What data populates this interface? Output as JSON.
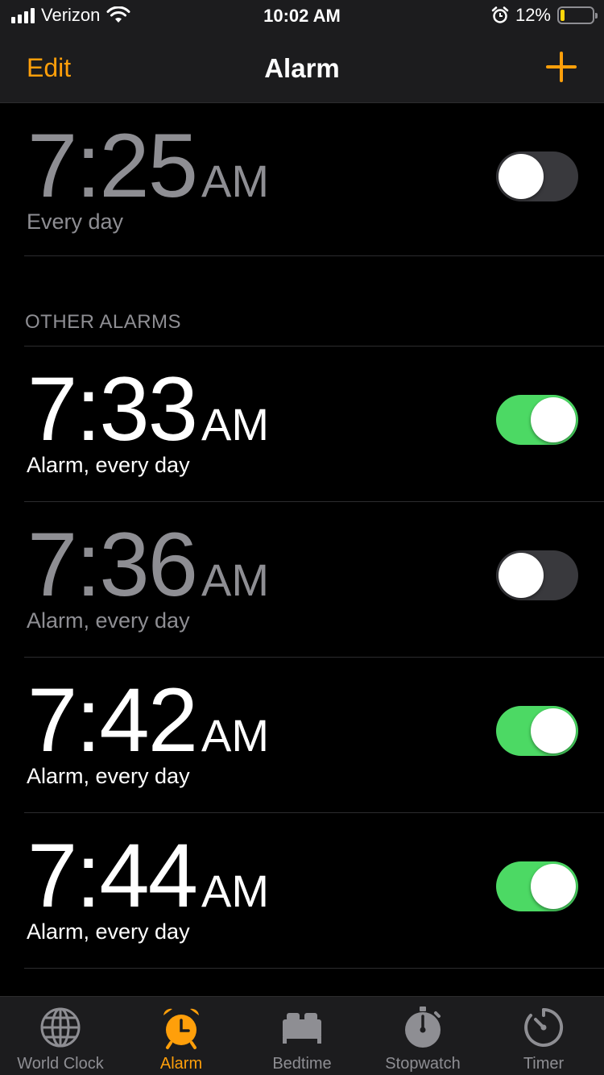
{
  "status_bar": {
    "carrier": "Verizon",
    "time": "10:02 AM",
    "battery_percent": "12%",
    "battery_level": 0.12,
    "icons": [
      "signal-icon",
      "wifi-icon",
      "alarm-clock-icon",
      "battery-icon"
    ]
  },
  "nav": {
    "edit_label": "Edit",
    "title": "Alarm",
    "add_icon": "plus-icon"
  },
  "bedtime_alarm": {
    "time": "7:25",
    "ampm": "AM",
    "label": "Every day",
    "enabled": false
  },
  "other_alarms": {
    "header": "OTHER ALARMS",
    "items": [
      {
        "time": "7:33",
        "ampm": "AM",
        "label": "Alarm, every day",
        "enabled": true
      },
      {
        "time": "7:36",
        "ampm": "AM",
        "label": "Alarm, every day",
        "enabled": false
      },
      {
        "time": "7:42",
        "ampm": "AM",
        "label": "Alarm, every day",
        "enabled": true
      },
      {
        "time": "7:44",
        "ampm": "AM",
        "label": "Alarm, every day",
        "enabled": true
      }
    ]
  },
  "tabs": [
    {
      "label": "World Clock",
      "icon": "globe-icon",
      "active": false
    },
    {
      "label": "Alarm",
      "icon": "alarm-clock-icon",
      "active": true
    },
    {
      "label": "Bedtime",
      "icon": "bed-icon",
      "active": false
    },
    {
      "label": "Stopwatch",
      "icon": "stopwatch-icon",
      "active": false
    },
    {
      "label": "Timer",
      "icon": "timer-icon",
      "active": false
    }
  ],
  "colors": {
    "accent": "#ff9f0a",
    "toggle_on": "#4cd964",
    "toggle_off": "#39393d",
    "inactive_text": "#8e8e93",
    "battery_low": "#ffd60a"
  }
}
